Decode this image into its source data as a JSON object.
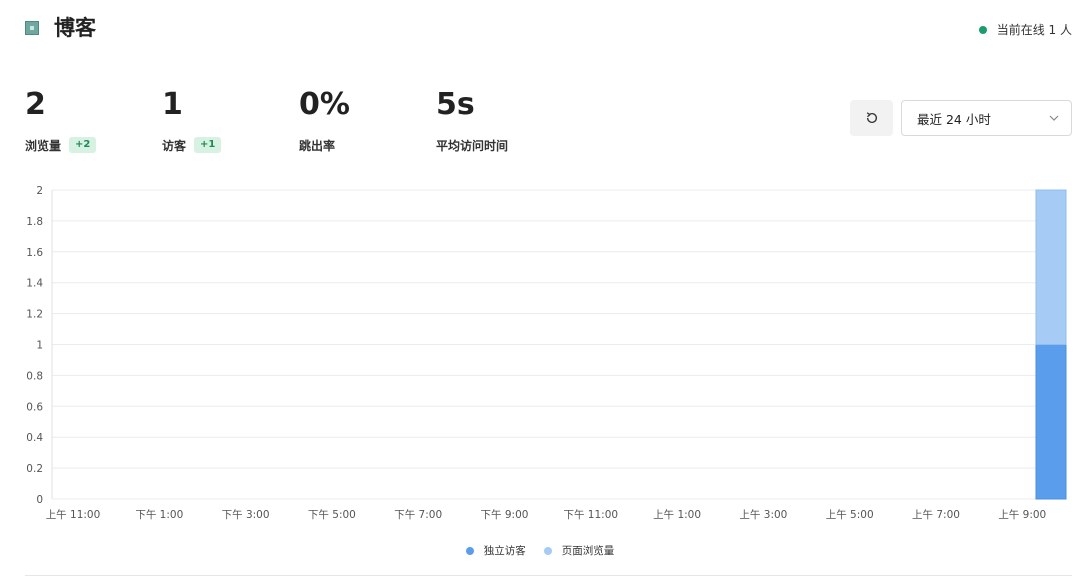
{
  "header": {
    "title": "博客",
    "online_text": "当前在线 1 人",
    "online_color": "#1a9c6c",
    "site_icon": "website-favicon-icon"
  },
  "metrics": [
    {
      "value": "2",
      "label": "浏览量",
      "change": "+2"
    },
    {
      "value": "1",
      "label": "访客",
      "change": "+1"
    },
    {
      "value": "0%",
      "label": "跳出率",
      "change": ""
    },
    {
      "value": "5s",
      "label": "平均访问时间",
      "change": ""
    }
  ],
  "controls": {
    "refresh_icon": "refresh-icon",
    "range_label": "最近 24 小时",
    "dropdown_icon": "chevron-down-icon"
  },
  "chart_data": {
    "type": "bar",
    "stacked": true,
    "ylim": [
      0,
      2
    ],
    "y_ticks": [
      "0",
      "0.2",
      "0.4",
      "0.6",
      "0.8",
      "1",
      "1.2",
      "1.4",
      "1.6",
      "1.8",
      "2"
    ],
    "x_tick_labels": [
      "上午 11:00",
      "下午 1:00",
      "下午 3:00",
      "下午 5:00",
      "下午 7:00",
      "下午 9:00",
      "下午 11:00",
      "上午 1:00",
      "上午 3:00",
      "上午 5:00",
      "上午 7:00",
      "上午 9:00"
    ],
    "grid": true,
    "bar_count": 24,
    "series": [
      {
        "name": "独立访客",
        "color": "#5b9ded",
        "values": [
          0,
          0,
          0,
          0,
          0,
          0,
          0,
          0,
          0,
          0,
          0,
          0,
          0,
          0,
          0,
          0,
          0,
          0,
          0,
          0,
          0,
          0,
          0,
          1
        ]
      },
      {
        "name": "页面浏览量",
        "color": "#a6cbf4",
        "values": [
          0,
          0,
          0,
          0,
          0,
          0,
          0,
          0,
          0,
          0,
          0,
          0,
          0,
          0,
          0,
          0,
          0,
          0,
          0,
          0,
          0,
          0,
          0,
          1
        ]
      }
    ],
    "legend_position": "bottom-center"
  }
}
